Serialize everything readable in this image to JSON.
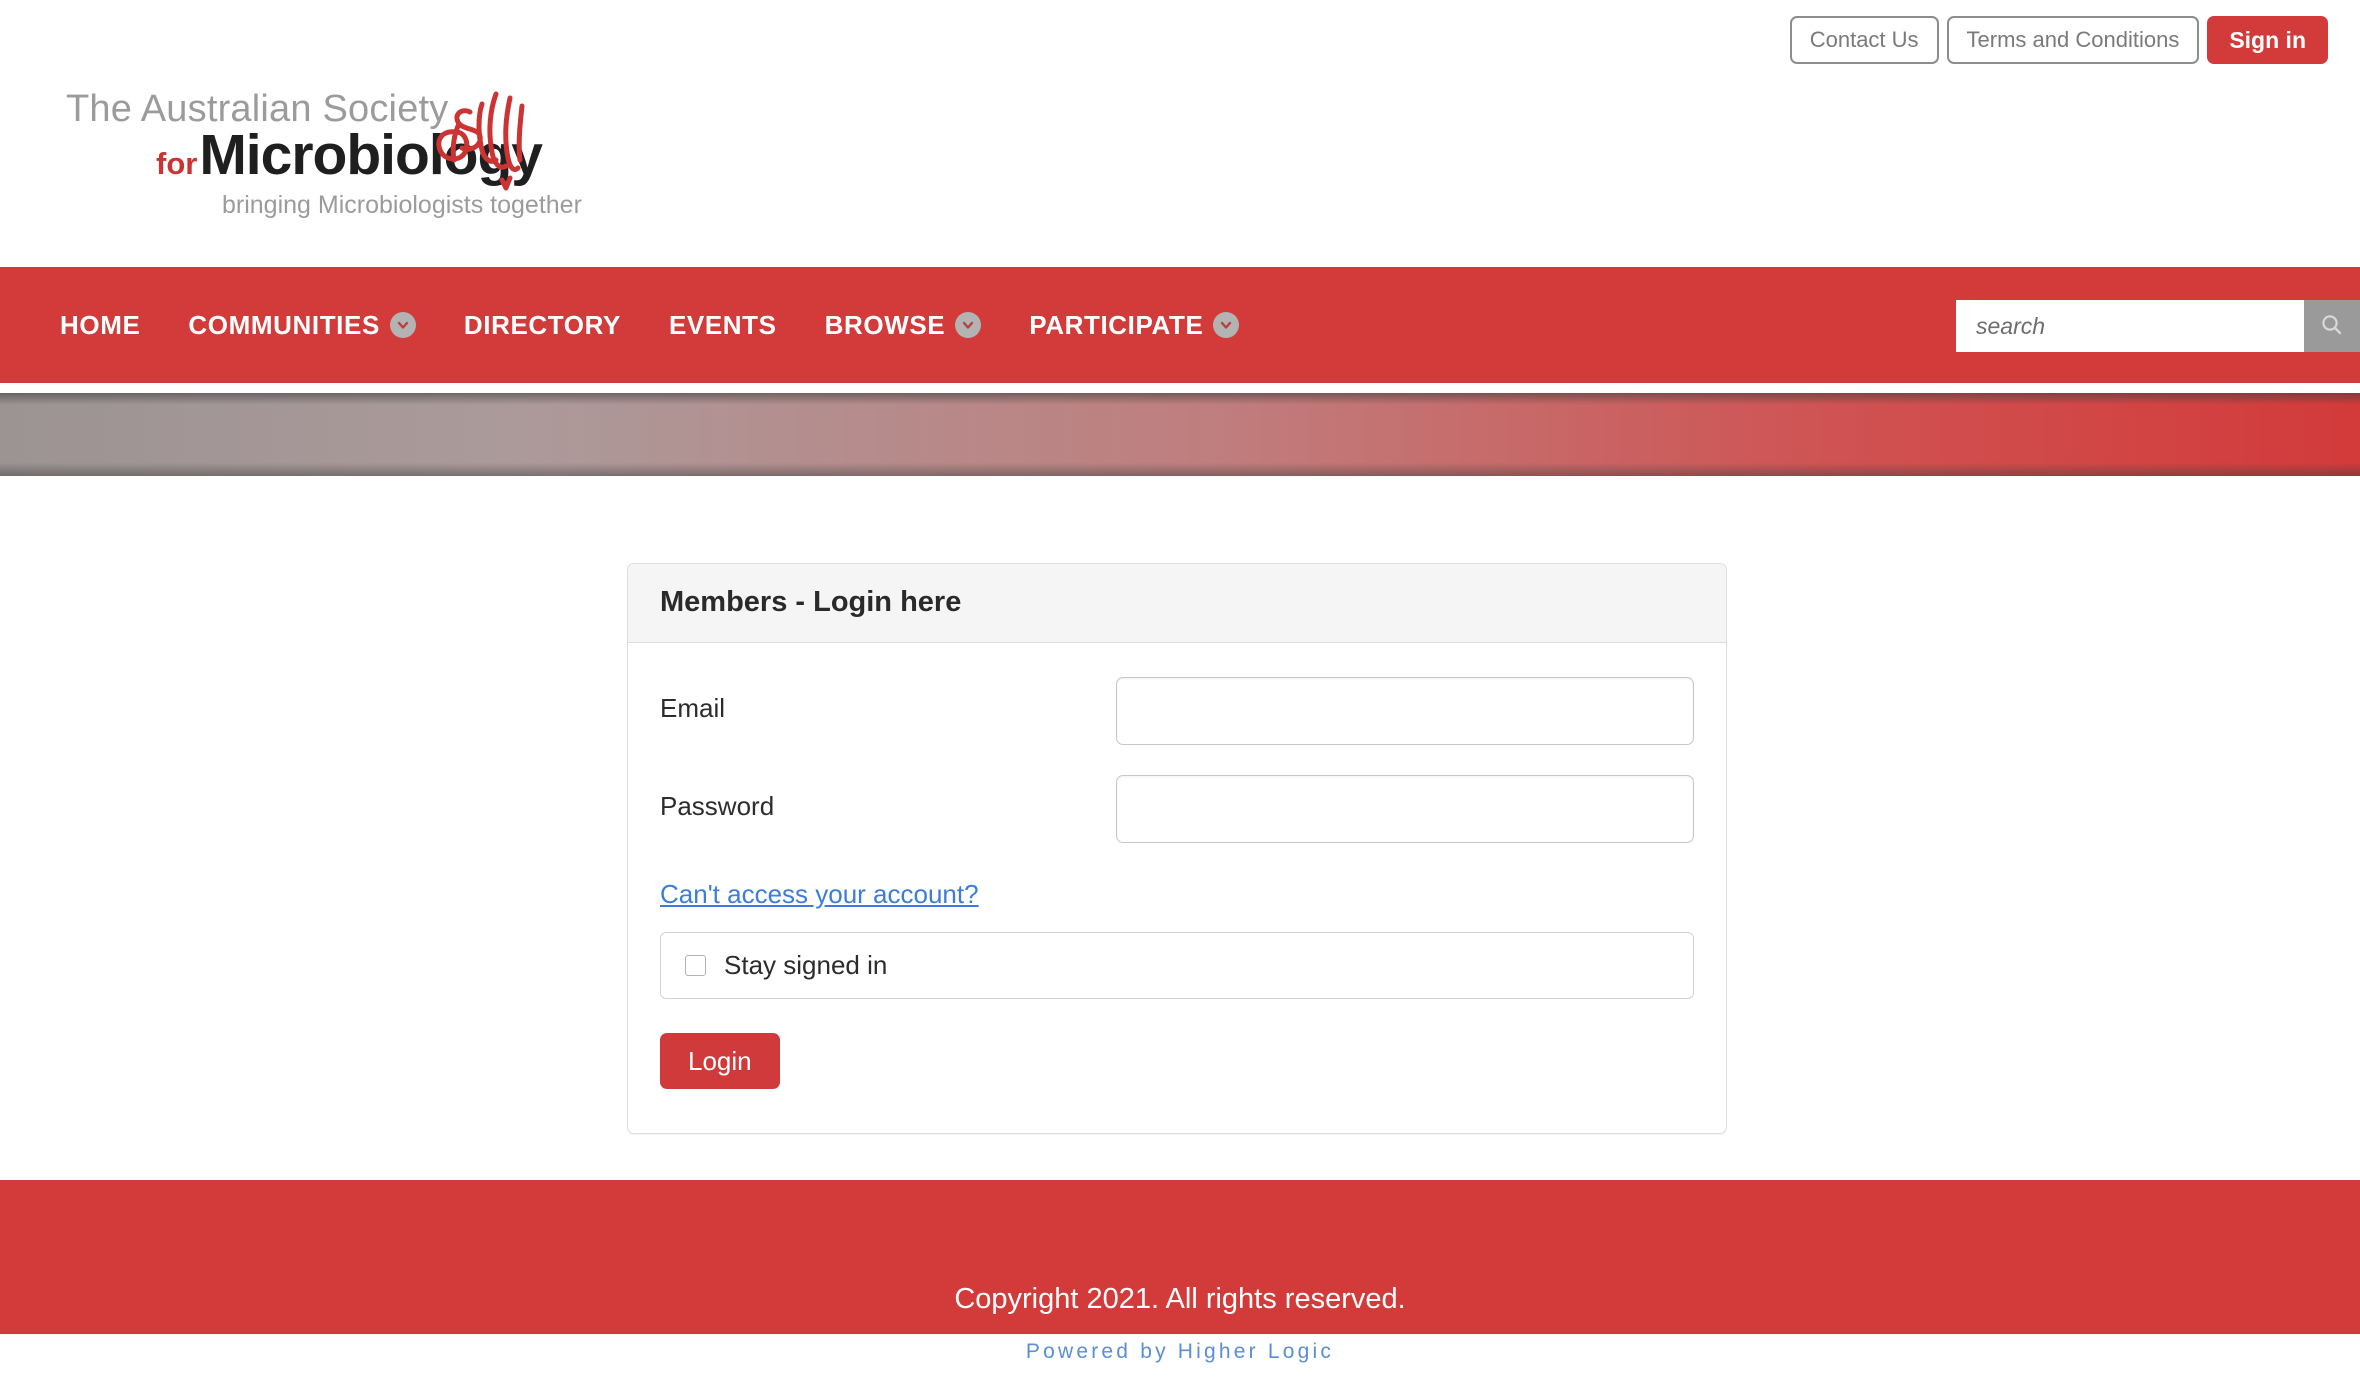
{
  "topbar": {
    "contact_label": "Contact Us",
    "terms_label": "Terms and Conditions",
    "signin_label": "Sign in"
  },
  "logo": {
    "line1": "The Australian Society",
    "for": "for",
    "name": "Microbiology",
    "tagline": "bringing Microbiologists together",
    "mark_color": "#cc3333"
  },
  "nav": {
    "items": [
      {
        "label": "HOME",
        "has_dropdown": false
      },
      {
        "label": "COMMUNITIES",
        "has_dropdown": true
      },
      {
        "label": "DIRECTORY",
        "has_dropdown": false
      },
      {
        "label": "EVENTS",
        "has_dropdown": false
      },
      {
        "label": "BROWSE",
        "has_dropdown": true
      },
      {
        "label": "PARTICIPATE",
        "has_dropdown": true
      }
    ],
    "background": "#d33a3a"
  },
  "search": {
    "placeholder": "search",
    "value": "",
    "icon": "search-icon",
    "button_color": "#9a9a9a"
  },
  "banner": {
    "gradient_from": "#9c9393",
    "gradient_to": "#d33a3a"
  },
  "login": {
    "title": "Members - Login here",
    "email_label": "Email",
    "email_value": "",
    "password_label": "Password",
    "password_value": "",
    "forgot_label": "Can't access your account?",
    "stay_signed_in_label": "Stay signed in",
    "stay_signed_in_checked": false,
    "submit_label": "Login",
    "submit_color": "#d03a3a"
  },
  "footer": {
    "copyright": "Copyright 2021. All rights reserved.",
    "powered_by": "Powered by Higher Logic",
    "band_color": "#d33a3a",
    "powered_color": "#5b8ed4"
  }
}
